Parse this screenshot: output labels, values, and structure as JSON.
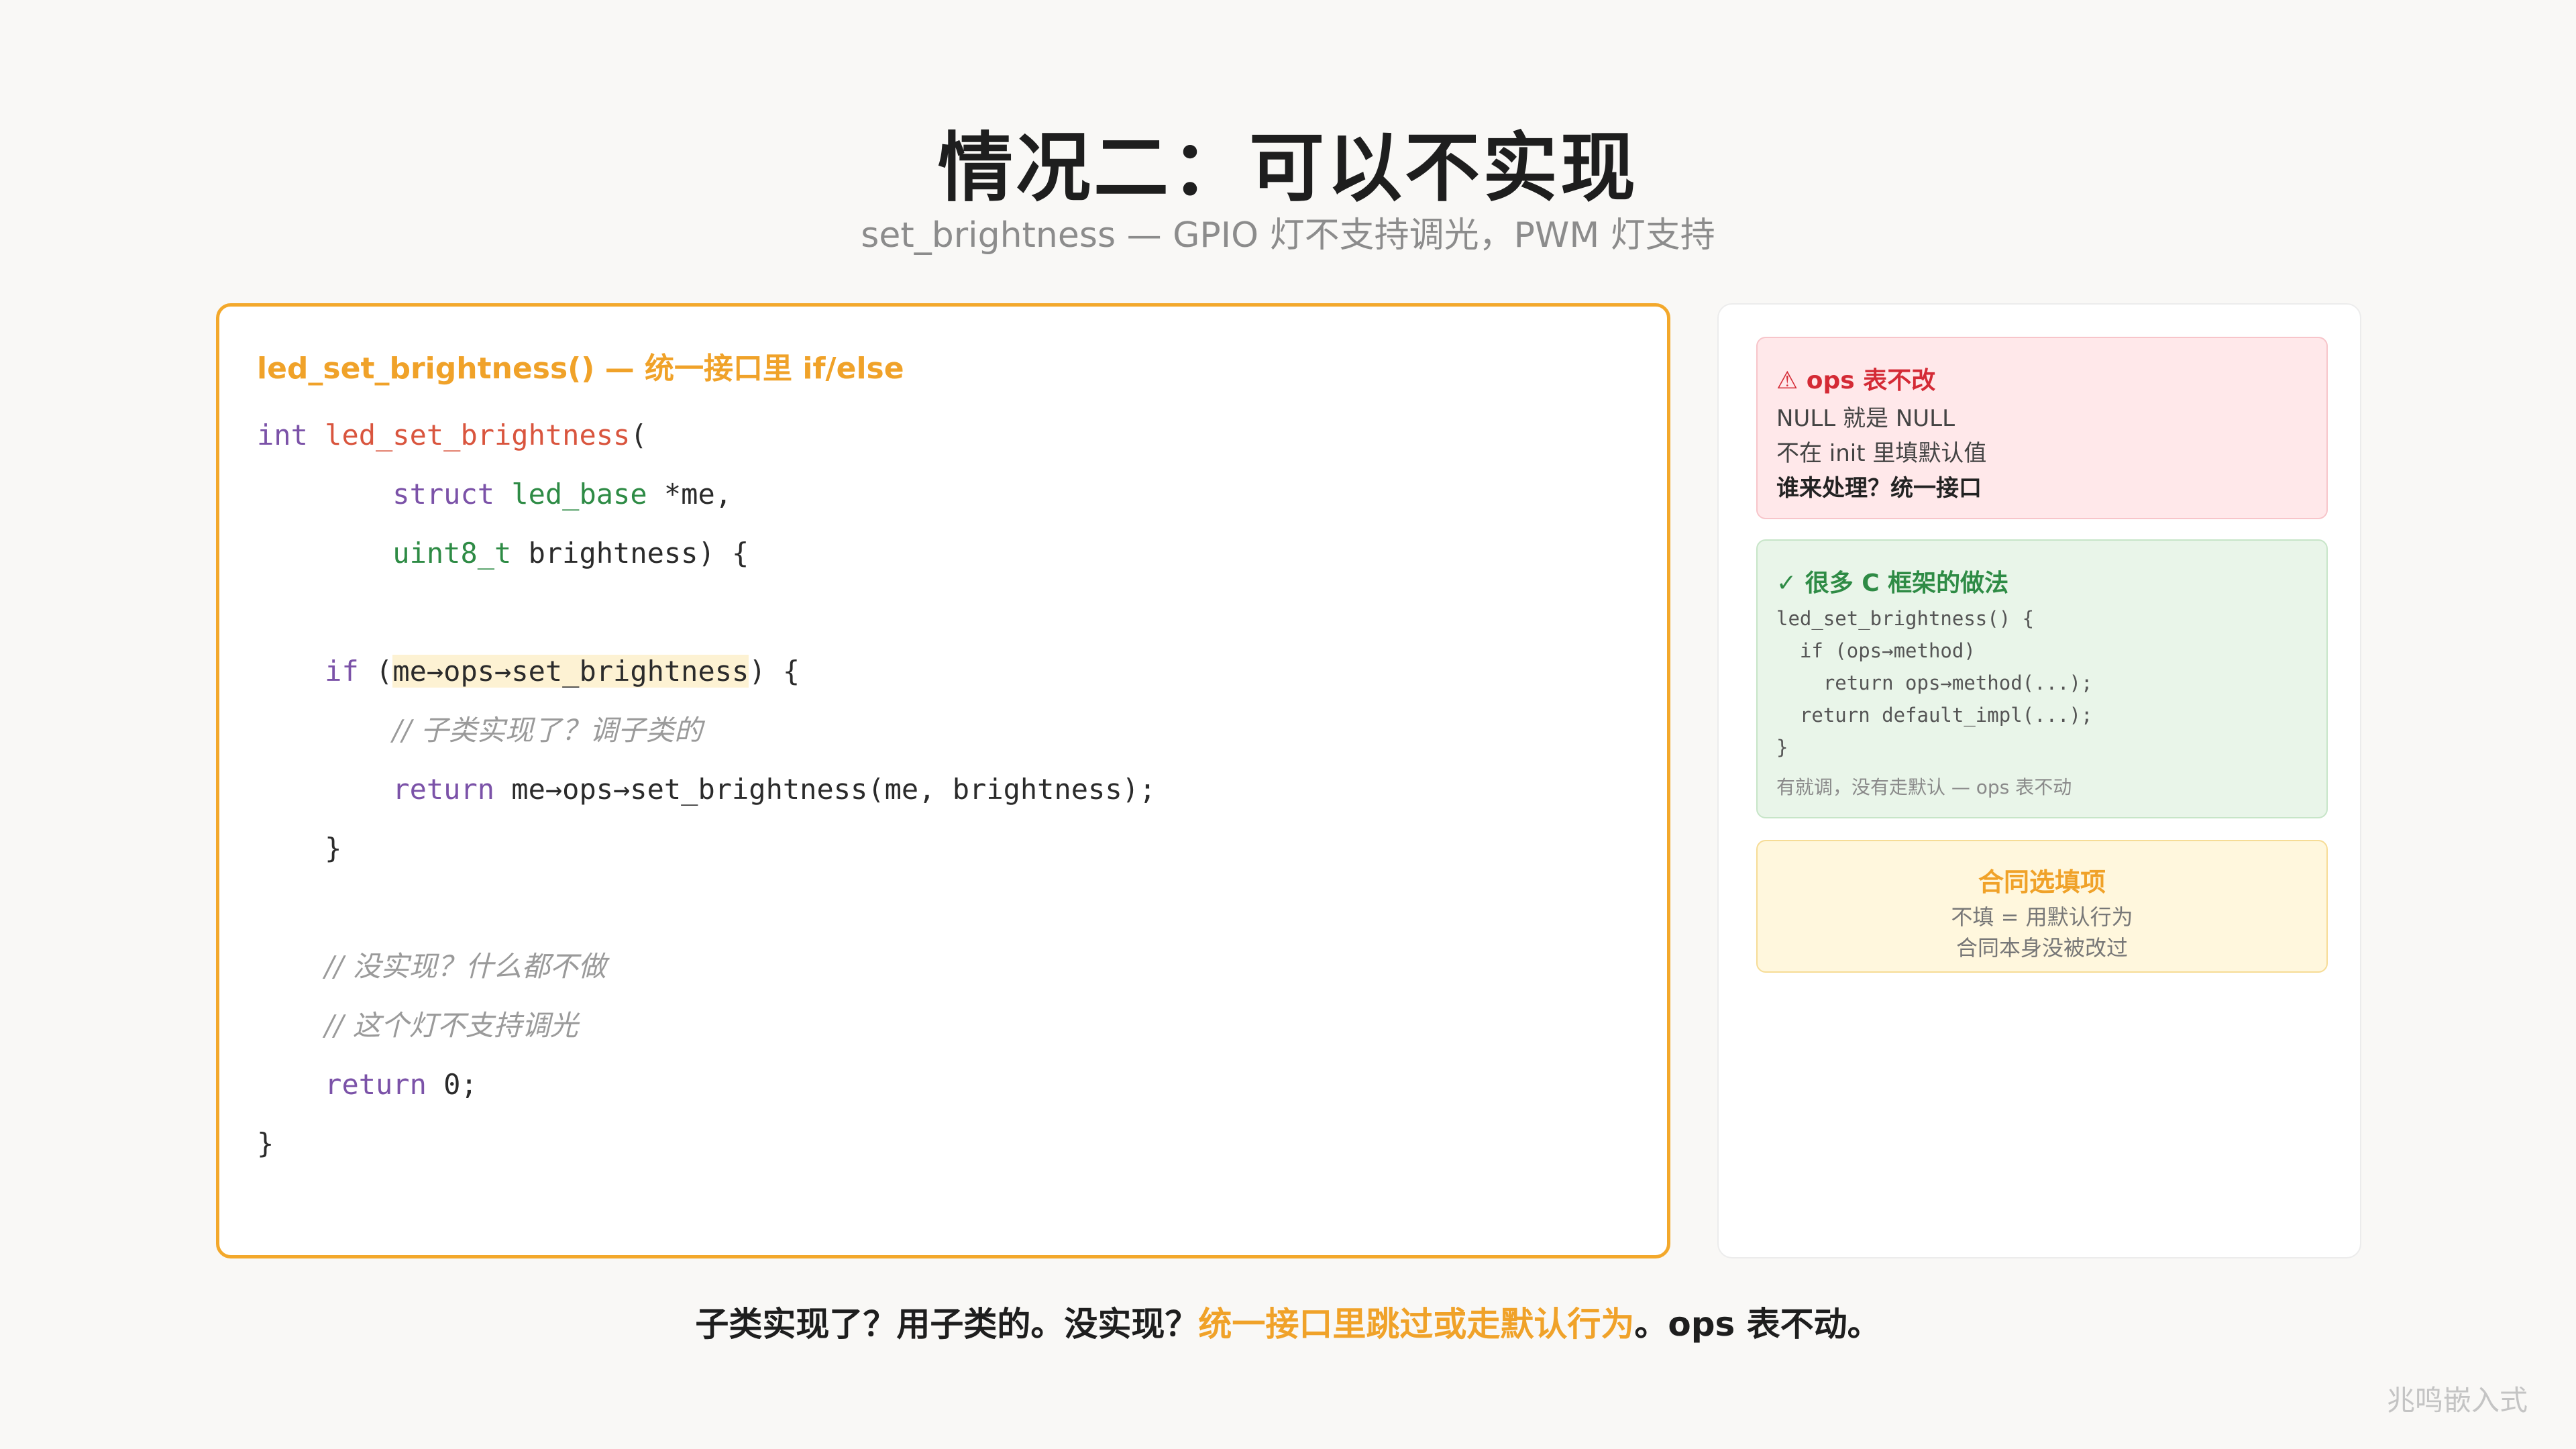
{
  "title": "情况二：可以不实现",
  "subtitle": "set_brightness — GPIO 灯不支持调光，PWM 灯支持",
  "code_panel": {
    "caption": "led_set_brightness() — 统一接口里 if/else",
    "l1_kw": "int",
    "l1_fn": "led_set_brightness",
    "l1_rest": "(",
    "l2_kw": "struct",
    "l2_ty": "led_base",
    "l2_rest": " *me,",
    "l3_ty": "uint8_t",
    "l3_rest": " brightness) {",
    "l5_kw": "if",
    "l5_open": " (",
    "l5_cond": "me→ops→set_brightness",
    "l5_close": ") {",
    "l6_comment": "// 子类实现了？调子类的",
    "l7_kw": "return",
    "l7_rest": " me→ops→set_brightness(me, brightness);",
    "l8": "}",
    "l10_comment": "// 没实现？什么都不做",
    "l11_comment": "// 这个灯不支持调光",
    "l12_kw": "return",
    "l12_rest": " 0;",
    "l13": "}"
  },
  "side": {
    "red": {
      "title": "⚠ ops 表不改",
      "line1": "NULL 就是 NULL",
      "line2": "不在 init 里填默认值",
      "line3": "谁来处理？统一接口"
    },
    "green": {
      "title": "✓ 很多 C 框架的做法",
      "code1": "led_set_brightness() {",
      "code2": "  if (ops→method)",
      "code3": "    return ops→method(...);",
      "code4": "  return default_impl(...);",
      "code5": "}",
      "note": "有就调，没有走默认 — ops 表不动"
    },
    "yellow": {
      "title": "合同选填项",
      "line1": "不填 = 用默认行为",
      "line2": "合同本身没被改过"
    }
  },
  "bottom": {
    "part1": "子类实现了？用子类的。没实现？",
    "accent": "统一接口里跳过或走默认行为",
    "part2": "。ops 表不动。"
  },
  "watermark": "兆鸣嵌入式",
  "colors": {
    "accent": "#f3a82b",
    "keyword": "#7b52a8",
    "function": "#d9553e",
    "type": "#2e8b45",
    "warning": "#d42a35"
  }
}
